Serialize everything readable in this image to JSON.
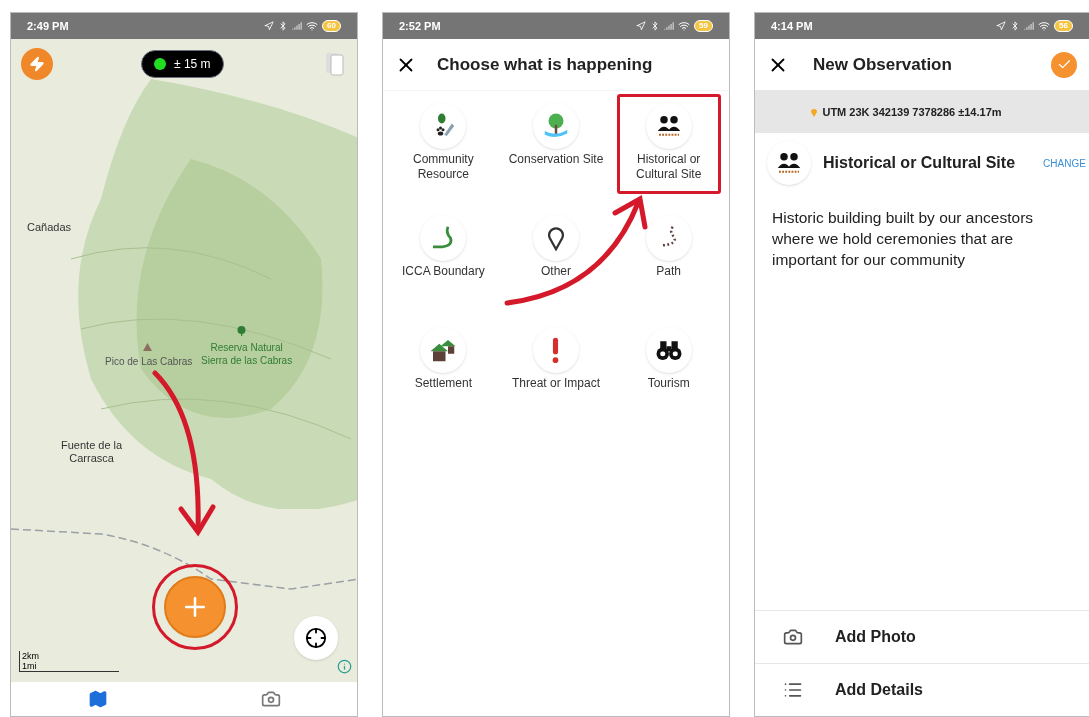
{
  "screens": [
    {
      "kind": "map",
      "status_bar": {
        "time": "2:49 PM",
        "battery": "60"
      },
      "gps_badge": {
        "text": "± 15 m",
        "fix": true
      },
      "map_labels": [
        {
          "kind": "place",
          "text": "Cañadas"
        },
        {
          "kind": "peak",
          "text": "Pico de Las Cabras"
        },
        {
          "kind": "park",
          "text": "Reserva Natural\nSierra de las Cabras"
        },
        {
          "kind": "place",
          "text": "Fuente de la\nCarrasca"
        }
      ],
      "scale": {
        "top": "2km",
        "bottom": "1mi"
      },
      "add_highlighted": true,
      "bottom_nav": [
        {
          "kind": "map",
          "selected": true
        },
        {
          "kind": "camera",
          "selected": false
        }
      ]
    },
    {
      "kind": "categories",
      "status_bar": {
        "time": "2:52 PM",
        "battery": "59"
      },
      "title": "Choose what is happening",
      "categories": [
        {
          "kind": "community",
          "label": "Community Resource",
          "selected": false
        },
        {
          "kind": "conservation",
          "label": "Conservation Site",
          "selected": false
        },
        {
          "kind": "people",
          "label": "Historical or Cultural Site",
          "selected": true
        },
        {
          "kind": "boundary",
          "label": "ICCA Boundary",
          "selected": false
        },
        {
          "kind": "pin",
          "label": "Other",
          "selected": false
        },
        {
          "kind": "path",
          "label": "Path",
          "selected": false
        },
        {
          "kind": "house",
          "label": "Settlement",
          "selected": false
        },
        {
          "kind": "alert",
          "label": "Threat or Impact",
          "selected": false
        },
        {
          "kind": "binoculars",
          "label": "Tourism",
          "selected": false
        }
      ]
    },
    {
      "kind": "observation",
      "status_bar": {
        "time": "4:14 PM",
        "battery": "56"
      },
      "title": "New Observation",
      "location": "UTM 23K 342139 7378286 ±14.17m",
      "category": {
        "kind": "people",
        "label": "Historical or Cultural Site",
        "action": "CHANGE"
      },
      "notes": "Historic building built by our ancestors where we hold ceremonies that are important for our community",
      "actions": [
        {
          "kind": "camera",
          "label": "Add Photo"
        },
        {
          "kind": "list",
          "label": "Add Details"
        }
      ]
    }
  ]
}
